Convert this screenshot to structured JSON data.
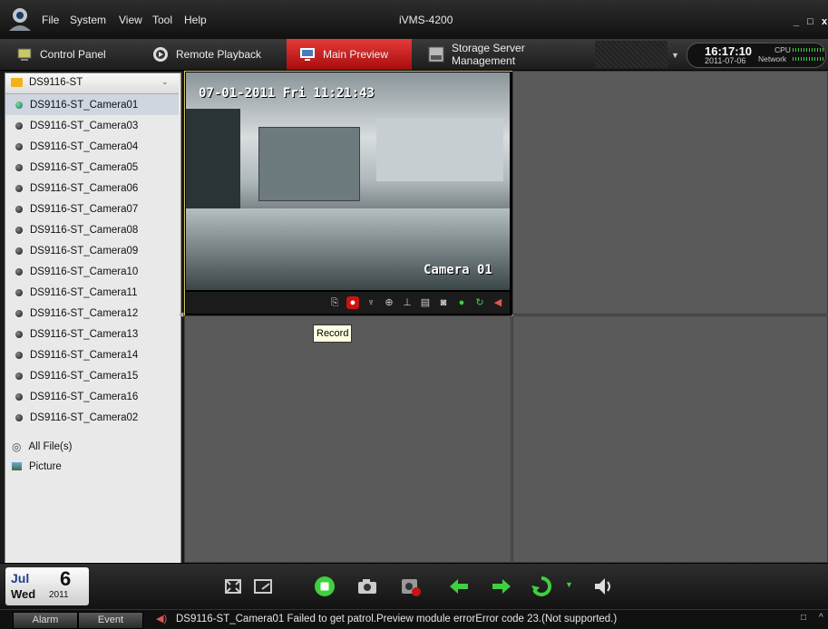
{
  "menu": {
    "items": [
      "File",
      "System",
      "View",
      "Tool",
      "Help"
    ],
    "app_title": "iVMS-4200",
    "min": "_",
    "max": "□",
    "close": "x"
  },
  "tabs": [
    {
      "label": "Control Panel",
      "icon": "control-panel-icon"
    },
    {
      "label": "Remote Playback",
      "icon": "playback-icon"
    },
    {
      "label": "Main Preview",
      "icon": "monitor-icon",
      "active": true
    },
    {
      "label": "Storage Server Management",
      "icon": "nvr-icon"
    }
  ],
  "clock": {
    "time": "16:17:10",
    "date": "2011-07-06",
    "cpu_label": "CPU",
    "network_label": "Network"
  },
  "sidebar": {
    "device": "DS9116-ST",
    "cameras": [
      "DS9116-ST_Camera01",
      "DS9116-ST_Camera03",
      "DS9116-ST_Camera04",
      "DS9116-ST_Camera05",
      "DS9116-ST_Camera06",
      "DS9116-ST_Camera07",
      "DS9116-ST_Camera08",
      "DS9116-ST_Camera09",
      "DS9116-ST_Camera10",
      "DS9116-ST_Camera11",
      "DS9116-ST_Camera12",
      "DS9116-ST_Camera13",
      "DS9116-ST_Camera14",
      "DS9116-ST_Camera15",
      "DS9116-ST_Camera16",
      "DS9116-ST_Camera02"
    ],
    "selected_index": 0,
    "extra": [
      "All File(s)",
      "Picture"
    ]
  },
  "preview": {
    "osd_time": "07-01-2011 Fri 11:21:43",
    "osd_camera": "Camera 01",
    "tooltip": "Record"
  },
  "date": {
    "month": "Jul",
    "day": "6",
    "weekday": "Wed",
    "year": "2011"
  },
  "status": {
    "tabs": [
      "Alarm",
      "Event"
    ],
    "message": "DS9116-ST_Camera01 Failed to get patrol.Preview module errorError code 23.(Not supported.)"
  },
  "colors": {
    "accent": "#c81414",
    "pane_border": "#d6c85b",
    "green": "#3fcf3f"
  }
}
